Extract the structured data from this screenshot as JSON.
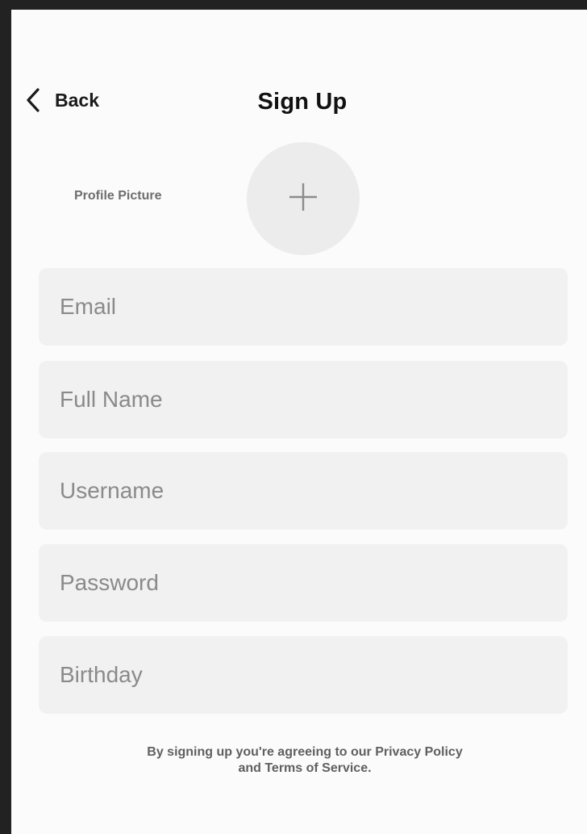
{
  "header": {
    "back_label": "Back",
    "title": "Sign Up",
    "back_icon": "chevron-left-icon"
  },
  "profile": {
    "label": "Profile Picture",
    "add_icon": "plus-icon"
  },
  "form": {
    "email_placeholder": "Email",
    "full_name_placeholder": "Full Name",
    "username_placeholder": "Username",
    "password_placeholder": "Password",
    "birthday_placeholder": "Birthday"
  },
  "legal": {
    "line1": "By signing up you're agreeing to our Privacy Policy",
    "line2": "and Terms of Service."
  },
  "colors": {
    "background": "#fbfbfb",
    "field_background": "#f1f1f1",
    "avatar_background": "#ececec",
    "placeholder_text": "#8a8a8a"
  }
}
